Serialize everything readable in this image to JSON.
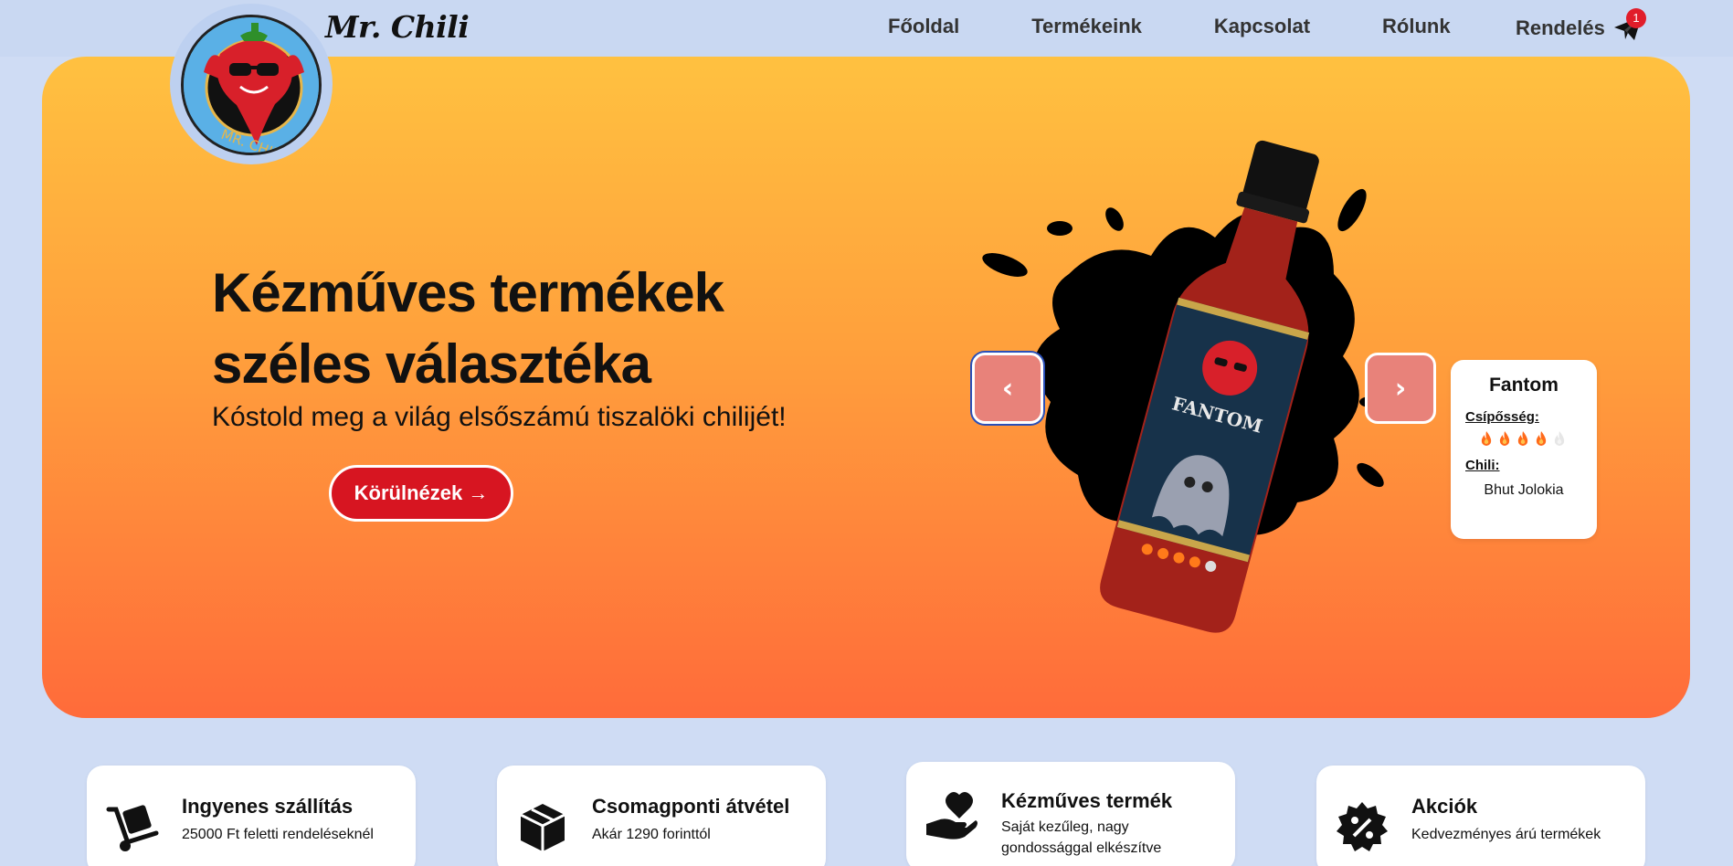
{
  "brand": {
    "name": "Mr. Chili",
    "logo_text": "MR. CHILI"
  },
  "nav": {
    "items": [
      {
        "label": "Főoldal"
      },
      {
        "label": "Termékeink"
      },
      {
        "label": "Kapcsolat"
      },
      {
        "label": "Rólunk"
      }
    ],
    "order_label": "Rendelés",
    "cart_count": "1"
  },
  "hero": {
    "title": "Kézműves termékek széles választéka",
    "subtitle": "Kóstold meg a világ elsőszámú tiszalöki chilijét!",
    "cta_label": "Körülnézek →"
  },
  "carousel": {
    "prev_label": "‹",
    "next_label": "›",
    "product": {
      "name": "Fantom",
      "bottle_label": "FANTOM",
      "heat_label": "Csípősség:",
      "heat_level": 4,
      "heat_max": 5,
      "chili_label": "Chili:",
      "chili_value": "Bhut Jolokia"
    }
  },
  "features": [
    {
      "title": "Ingyenes szállítás",
      "desc": "25000 Ft feletti rendeléseknél",
      "icon": "hand-truck-icon"
    },
    {
      "title": "Csomagponti átvétel",
      "desc": "Akár 1290 forinttól",
      "icon": "package-icon"
    },
    {
      "title": "Kézműves termék",
      "desc": "Saját kezűleg, nagy gondossággal elkészítve",
      "icon": "hand-heart-icon"
    },
    {
      "title": "Akciók",
      "desc": "Kedvezményes árú termékek",
      "icon": "discount-badge-icon"
    }
  ],
  "colors": {
    "page_bg": "#cfdcf4",
    "hero_top": "#ffc140",
    "hero_bottom": "#ff6b3a",
    "cta": "#d71521",
    "carousel_button": "#e8827a",
    "badge": "#e11d2a"
  }
}
